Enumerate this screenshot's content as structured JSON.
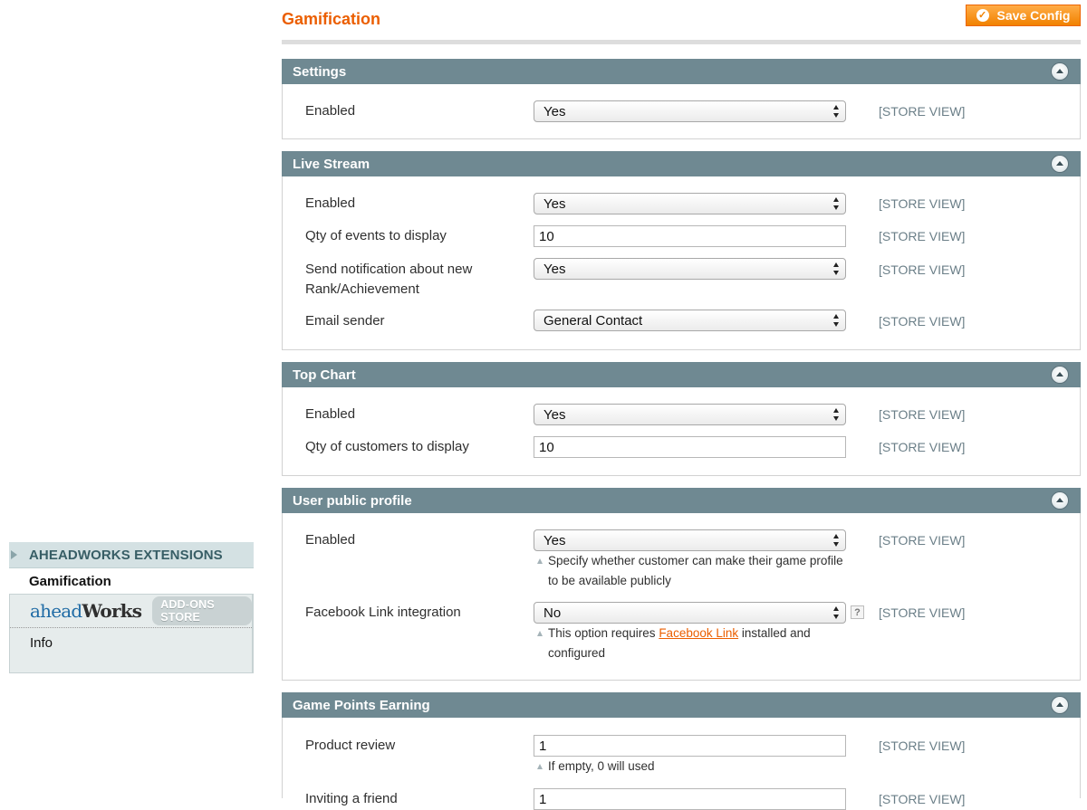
{
  "sidebar": {
    "group_label": "AHEADWORKS EXTENSIONS",
    "active_item": "Gamification",
    "logo_part1": "ahead",
    "logo_part2": "Works",
    "store_badge": "ADD-ONS STORE",
    "info_item": "Info"
  },
  "page": {
    "title": "Gamification",
    "save_label": "Save Config"
  },
  "scope_label": "[STORE VIEW]",
  "settings": {
    "title": "Settings",
    "enabled_label": "Enabled",
    "enabled_value": "Yes"
  },
  "live_stream": {
    "title": "Live Stream",
    "enabled_label": "Enabled",
    "enabled_value": "Yes",
    "qty_label": "Qty of events to display",
    "qty_value": "10",
    "notify_label_line1": "Send notification about new",
    "notify_label_line2": "Rank/Achievement",
    "notify_value": "Yes",
    "sender_label": "Email sender",
    "sender_value": "General Contact"
  },
  "top_chart": {
    "title": "Top Chart",
    "enabled_label": "Enabled",
    "enabled_value": "Yes",
    "qty_label": "Qty of customers to display",
    "qty_value": "10"
  },
  "user_profile": {
    "title": "User public profile",
    "enabled_label": "Enabled",
    "enabled_value": "Yes",
    "enabled_note_line1": "Specify whether customer can make their game profile",
    "enabled_note_line2": "to be available publicly",
    "fb_label": "Facebook Link integration",
    "fb_value": "No",
    "help_glyph": "?",
    "fb_note_pre": "This option requires ",
    "fb_note_link": "Facebook Link",
    "fb_note_post": " installed and",
    "fb_note_line2": "configured"
  },
  "game_points": {
    "title": "Game Points Earning",
    "review_label": "Product review",
    "review_value": "1",
    "review_note": "If empty, 0 will used",
    "invite_label": "Inviting a friend",
    "invite_value": "1"
  }
}
